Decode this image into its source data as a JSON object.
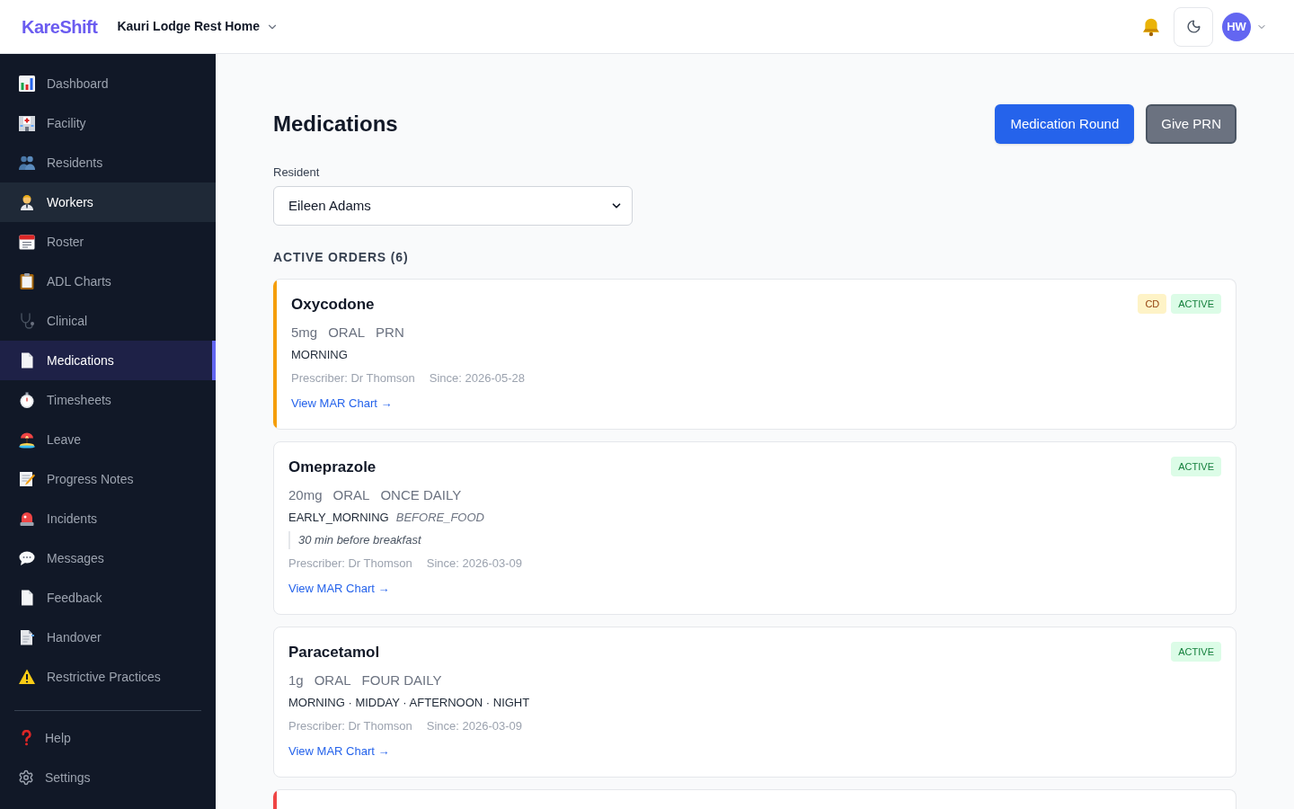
{
  "header": {
    "logo": "KareShift",
    "facility": "Kauri Lodge Rest Home",
    "avatar_initials": "HW"
  },
  "sidebar": {
    "items": [
      {
        "label": "Dashboard",
        "selected": false,
        "hovered": false
      },
      {
        "label": "Facility",
        "selected": false,
        "hovered": false
      },
      {
        "label": "Residents",
        "selected": false,
        "hovered": false
      },
      {
        "label": "Workers",
        "selected": false,
        "hovered": true
      },
      {
        "label": "Roster",
        "selected": false,
        "hovered": false
      },
      {
        "label": "ADL Charts",
        "selected": false,
        "hovered": false
      },
      {
        "label": "Clinical",
        "selected": false,
        "hovered": false
      },
      {
        "label": "Medications",
        "selected": true,
        "hovered": false
      },
      {
        "label": "Timesheets",
        "selected": false,
        "hovered": false
      },
      {
        "label": "Leave",
        "selected": false,
        "hovered": false
      },
      {
        "label": "Progress Notes",
        "selected": false,
        "hovered": false
      },
      {
        "label": "Incidents",
        "selected": false,
        "hovered": false
      },
      {
        "label": "Messages",
        "selected": false,
        "hovered": false
      },
      {
        "label": "Feedback",
        "selected": false,
        "hovered": false
      },
      {
        "label": "Handover",
        "selected": false,
        "hovered": false
      },
      {
        "label": "Restrictive Practices",
        "selected": false,
        "hovered": false
      }
    ],
    "footer_items": [
      {
        "label": "Help"
      },
      {
        "label": "Settings"
      }
    ]
  },
  "page": {
    "title": "Medications",
    "actions": [
      {
        "label": "Medication Round",
        "kind": "primary"
      },
      {
        "label": "Give PRN",
        "kind": "secondary"
      }
    ],
    "resident_field": {
      "label": "Resident",
      "value": "Eileen Adams"
    },
    "section_title": "ACTIVE ORDERS (6)"
  },
  "orders": [
    {
      "name": "Oxycodone",
      "color": "#f59e0b",
      "badges": [
        {
          "label": "CD",
          "kind": "controlled"
        },
        {
          "label": "ACTIVE",
          "kind": "status"
        }
      ],
      "dose": "5mg",
      "route": "ORAL",
      "frequency": "PRN",
      "times": "MORNING",
      "prescriber": "Prescriber: Dr Thomson",
      "since": "Since: 2026-05-28",
      "link": "View MAR Chart →"
    },
    {
      "name": "Omeprazole",
      "badges": [
        {
          "label": "ACTIVE",
          "kind": "status"
        }
      ],
      "dose": "20mg",
      "route": "ORAL",
      "frequency": "ONCE DAILY",
      "times": "EARLY_MORNING",
      "instruction": "BEFORE_FOOD",
      "note": "30 min before breakfast",
      "prescriber": "Prescriber: Dr Thomson",
      "since": "Since: 2026-03-09",
      "link": "View MAR Chart →"
    },
    {
      "name": "Paracetamol",
      "badges": [
        {
          "label": "ACTIVE",
          "kind": "status"
        }
      ],
      "dose": "1g",
      "route": "ORAL",
      "frequency": "FOUR DAILY",
      "times": "MORNING · MIDDAY · AFTERNOON · NIGHT",
      "prescriber": "Prescriber: Dr Thomson",
      "since": "Since: 2026-03-09",
      "link": "View MAR Chart →"
    },
    {
      "color": "#ef4444"
    }
  ]
}
